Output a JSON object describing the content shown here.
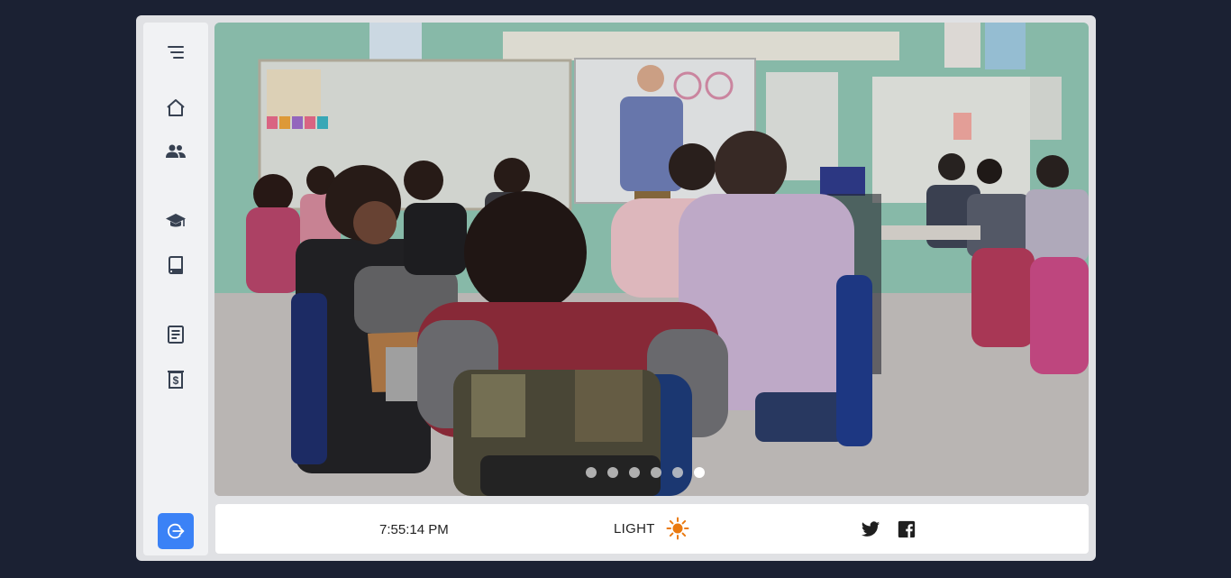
{
  "sidebar": {
    "icons": [
      "menu-icon",
      "home-icon",
      "users-icon",
      "graduation-cap-icon",
      "book-icon",
      "document-icon",
      "receipt-icon"
    ],
    "logout_icon": "logout-icon",
    "accent": "#3b82f6"
  },
  "carousel": {
    "slide_count": 6,
    "active_index": 5
  },
  "footer": {
    "time": "7:55:14 PM",
    "theme_label": "LIGHT",
    "theme_icon": "sun-icon",
    "sun_color": "#ea7a10",
    "social": [
      "twitter-icon",
      "facebook-icon"
    ]
  }
}
